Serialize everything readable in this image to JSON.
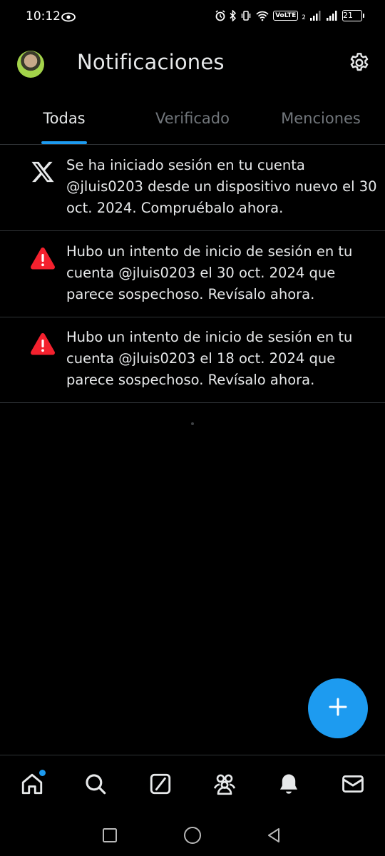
{
  "status_bar": {
    "time": "10:12",
    "volte": "VoLTE",
    "sim_label": "2",
    "battery": "21"
  },
  "header": {
    "title": "Notificaciones"
  },
  "tabs": [
    {
      "label": "Todas",
      "active": true
    },
    {
      "label": "Verificado",
      "active": false
    },
    {
      "label": "Menciones",
      "active": false
    }
  ],
  "notifications": [
    {
      "icon": "x-logo-icon",
      "text": "Se ha iniciado sesión en tu cuenta @jluis0203 desde un dispositivo nuevo el 30 oct. 2024. Compruébalo ahora."
    },
    {
      "icon": "warning-icon",
      "text": "Hubo un intento de inicio de sesión en tu cuenta @jluis0203 el 30 oct. 2024 que parece sospechoso. Revísalo ahora."
    },
    {
      "icon": "warning-icon",
      "text": "Hubo un intento de inicio de sesión en tu cuenta @jluis0203 el 18 oct. 2024 que parece sospechoso. Revísalo ahora."
    }
  ],
  "bottom_nav": [
    {
      "name": "home",
      "icon": "home-icon",
      "has_badge": true
    },
    {
      "name": "search",
      "icon": "search-icon",
      "has_badge": false
    },
    {
      "name": "grok",
      "icon": "grok-icon",
      "has_badge": false
    },
    {
      "name": "communities",
      "icon": "communities-icon",
      "has_badge": false
    },
    {
      "name": "notifications",
      "icon": "bell-icon",
      "has_badge": false,
      "active": true
    },
    {
      "name": "messages",
      "icon": "mail-icon",
      "has_badge": false
    }
  ],
  "colors": {
    "background": "#000000",
    "accent": "#1d9bf0",
    "text": "#e7e9ea",
    "muted": "#71767b",
    "warning": "#f4212e",
    "divider": "#2f3336"
  }
}
